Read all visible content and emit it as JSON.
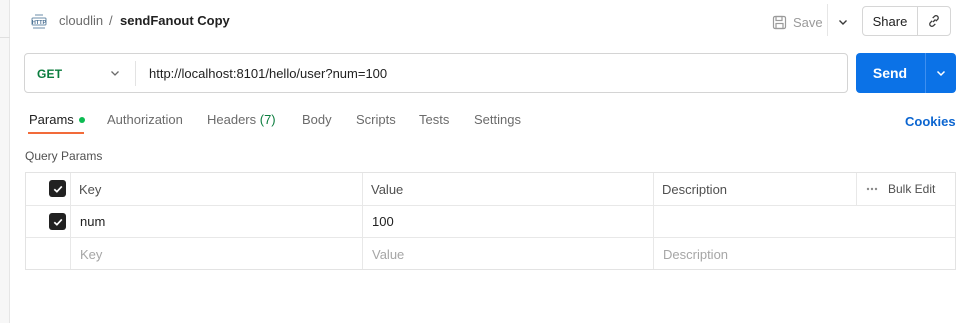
{
  "header": {
    "http_icon": "http-file-icon",
    "collection": "cloudlin",
    "separator": "/",
    "request_name": "sendFanout Copy",
    "save_label": "Save",
    "share_label": "Share",
    "link_icon": "link-icon"
  },
  "request": {
    "method": "GET",
    "url": "http://localhost:8101/hello/user?num=100",
    "send_label": "Send"
  },
  "tabs": [
    {
      "label": "Params",
      "active": true
    },
    {
      "label": "Authorization"
    },
    {
      "label": "Headers ",
      "count": "(7)"
    },
    {
      "label": "Body"
    },
    {
      "label": "Scripts"
    },
    {
      "label": "Tests"
    },
    {
      "label": "Settings"
    }
  ],
  "cookies_label": "Cookies",
  "query_params": {
    "title": "Query Params",
    "columns": {
      "key": "Key",
      "value": "Value",
      "description": "Description"
    },
    "bulk_edit_label": "Bulk Edit",
    "rows": [
      {
        "checked": true,
        "key": "num",
        "value": "100",
        "description": ""
      }
    ],
    "placeholder": {
      "key": "Key",
      "value": "Value",
      "description": "Description"
    }
  },
  "colors": {
    "method_green": "#0b7d3e",
    "send_blue": "#0b72e7",
    "active_tab_underline": "#f26b3a",
    "status_dot": "#0cbb52",
    "cookies_link": "#0b65d0"
  }
}
